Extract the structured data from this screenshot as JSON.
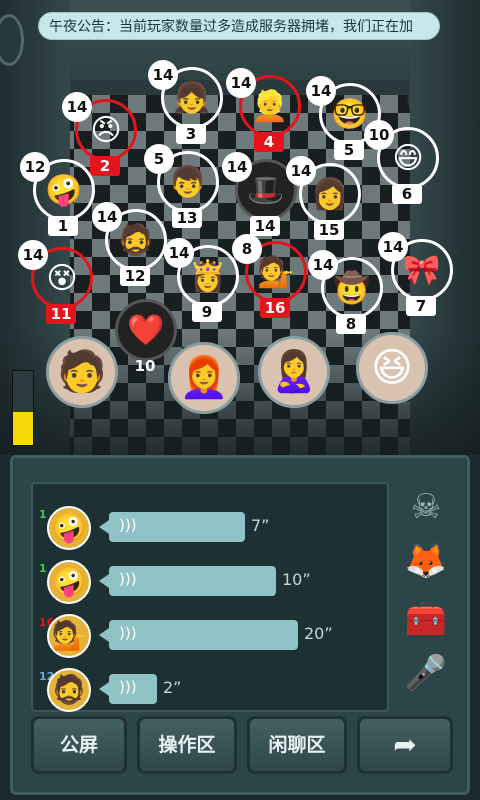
{
  "notice": {
    "text": "午夜公告：当前玩家数量过多造成服务器拥堵，我们正在加"
  },
  "players": [
    {
      "level": "14",
      "seat": "2",
      "highlight": "red",
      "face": "😠"
    },
    {
      "level": "14",
      "seat": "3",
      "highlight": "none",
      "face": "👧"
    },
    {
      "level": "14",
      "seat": "4",
      "highlight": "red",
      "face": "👱"
    },
    {
      "level": "14",
      "seat": "5",
      "highlight": "none",
      "face": "🤓"
    },
    {
      "level": "10",
      "seat": "6",
      "highlight": "none",
      "face": "😄"
    },
    {
      "level": "12",
      "seat": "1",
      "highlight": "none",
      "face": "🤪"
    },
    {
      "level": "5",
      "seat": "13",
      "highlight": "none",
      "face": "👦"
    },
    {
      "level": "14",
      "seat": "14",
      "highlight": "none",
      "face": "🎩",
      "dead": true
    },
    {
      "level": "14",
      "seat": "15",
      "highlight": "none",
      "face": "👩"
    },
    {
      "level": "14",
      "seat": "12",
      "highlight": "none",
      "face": "🧔"
    },
    {
      "level": "14",
      "seat": "11",
      "highlight": "red",
      "face": "😵"
    },
    {
      "level": "14",
      "seat": "9",
      "highlight": "none",
      "face": "👸"
    },
    {
      "level": "8",
      "seat": "16",
      "highlight": "red",
      "face": "💁"
    },
    {
      "level": "14",
      "seat": "8",
      "highlight": "none",
      "face": "🤠"
    },
    {
      "level": "14",
      "seat": "7",
      "highlight": "none",
      "face": "🎀"
    },
    {
      "level": "",
      "seat": "10",
      "highlight": "none",
      "face": "❤️",
      "dead": true
    }
  ],
  "spectators": [
    {
      "face": "🧑"
    },
    {
      "face": "👩‍🦰"
    },
    {
      "face": "🙎‍♀️"
    },
    {
      "face": "😆"
    }
  ],
  "timer": {
    "level": 0.45,
    "color": "#f6d80b"
  },
  "chat": {
    "messages": [
      {
        "level": "1",
        "level_color": "#3ecb42",
        "face": "🤪",
        "duration": "7”",
        "width": 0.62
      },
      {
        "level": "1",
        "level_color": "#3ecb42",
        "face": "🤪",
        "duration": "10”",
        "width": 0.76
      },
      {
        "level": "16",
        "level_color": "#e3141c",
        "face": "💁",
        "duration": "20”",
        "width": 0.86
      },
      {
        "level": "12",
        "level_color": "#6fa6d6",
        "face": "🧔",
        "duration": "2”",
        "width": 0.22
      }
    ]
  },
  "side_icons": [
    "skull-icon",
    "fox-icon",
    "chest-icon",
    "microphone-icon"
  ],
  "buttons": {
    "public": "公屏",
    "operate": "操作区",
    "chat": "闲聊区",
    "next": "➦"
  }
}
